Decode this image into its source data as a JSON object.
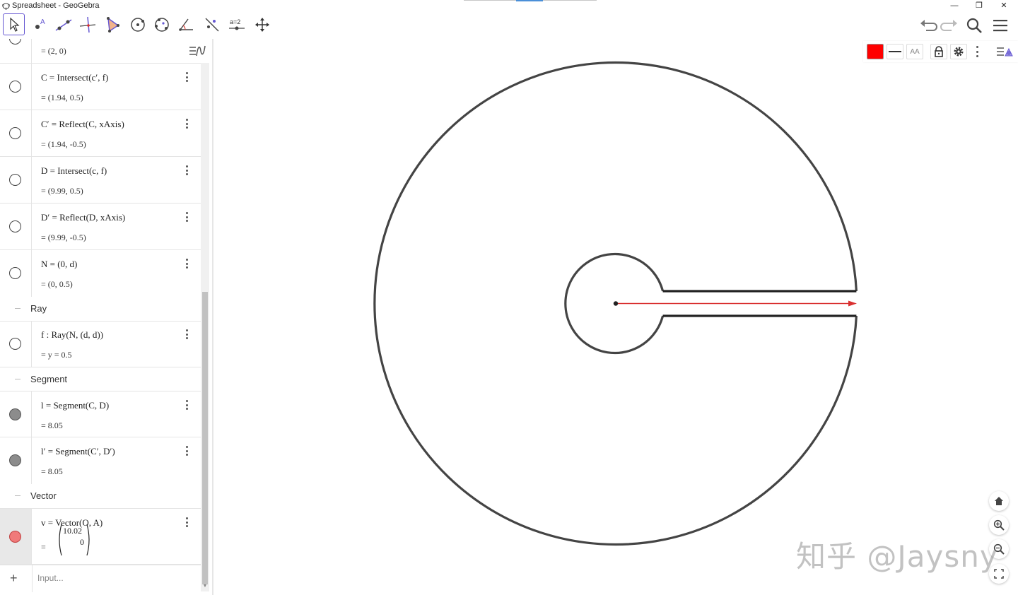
{
  "window": {
    "title": "Spreadsheet - GeoGebra",
    "minimize": "—",
    "restore": "❐",
    "close": "✕"
  },
  "toolbar": {
    "tools": [
      "move-tool",
      "point-tool",
      "line-tool",
      "perpendicular-line-tool",
      "polygon-tool",
      "circle-center-point-tool",
      "circle-three-points-tool",
      "angle-tool",
      "reflect-tool",
      "slider-tool",
      "move-graphics-view-tool"
    ],
    "slider_label": "a=2"
  },
  "algebra": {
    "rows": [
      {
        "def": "",
        "val": "=  (2, 0)"
      },
      {
        "def": "C  =  Intersect(c′, f)",
        "val": "=  (1.94, 0.5)"
      },
      {
        "def": "C′  =  Reflect(C, xAxis)",
        "val": "=  (1.94, -0.5)"
      },
      {
        "def": "D  =  Intersect(c, f)",
        "val": "=  (9.99, 0.5)"
      },
      {
        "def": "D′  =  Reflect(D, xAxis)",
        "val": "=  (9.99, -0.5)"
      },
      {
        "def": "N  =  (0,  d)",
        "val": "=  (0, 0.5)"
      },
      {
        "def": "f : Ray(N, (d,  d))",
        "val": "=  y = 0.5"
      },
      {
        "def": "l  =  Segment(C, D)",
        "val": "=  8.05"
      },
      {
        "def": "l′  =  Segment(C′, D′)",
        "val": "=  8.05"
      },
      {
        "def": "v  =  Vector(O, A)",
        "val": "="
      }
    ],
    "groups": [
      "Ray",
      "Segment",
      "Vector"
    ],
    "vector_top": "10.02",
    "vector_bottom": "0",
    "input_placeholder": "Input...",
    "input_plus": "+"
  },
  "style_bar": {
    "color": "#ff0000",
    "text_size_label": "AA"
  },
  "colors": {
    "accent": "#6557d2",
    "curve": "#444444",
    "vector": "#d93030"
  },
  "watermark": "知乎 @Jaysny"
}
